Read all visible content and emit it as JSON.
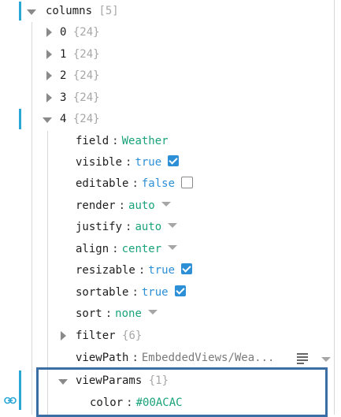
{
  "tree": {
    "root": {
      "key": "columns",
      "count": "[5]"
    },
    "collapsed_items": [
      {
        "key": "0",
        "count": "{24}"
      },
      {
        "key": "1",
        "count": "{24}"
      },
      {
        "key": "2",
        "count": "{24}"
      },
      {
        "key": "3",
        "count": "{24}"
      }
    ],
    "open_item": {
      "key": "4",
      "count": "{24}"
    },
    "props": {
      "field": {
        "key": "field",
        "value": "Weather"
      },
      "visible": {
        "key": "visible",
        "value": "true",
        "checked": true
      },
      "editable": {
        "key": "editable",
        "value": "false",
        "checked": false
      },
      "render": {
        "key": "render",
        "value": "auto"
      },
      "justify": {
        "key": "justify",
        "value": "auto"
      },
      "align": {
        "key": "align",
        "value": "center"
      },
      "resizable": {
        "key": "resizable",
        "value": "true",
        "checked": true
      },
      "sortable": {
        "key": "sortable",
        "value": "true",
        "checked": true
      },
      "sort": {
        "key": "sort",
        "value": "none"
      },
      "filter": {
        "key": "filter",
        "count": "{6}"
      },
      "viewPath": {
        "key": "viewPath",
        "value": "EmbeddedViews/Wea..."
      },
      "viewParams": {
        "key": "viewParams",
        "count": "{1}"
      },
      "color": {
        "key": "color",
        "value": "#00ACAC"
      }
    },
    "colon": ":"
  },
  "icons": {
    "expand": "chevron-right-icon",
    "collapse": "chevron-down-icon",
    "edit": "list-edit-icon",
    "dropdown": "dropdown-arrow-icon",
    "link": "link-icon"
  },
  "colors": {
    "accent_bar": "#2aa7d6",
    "string_value": "#1aa37a",
    "bool_value": "#2d8fd6",
    "highlight_border": "#3a6ea5"
  }
}
